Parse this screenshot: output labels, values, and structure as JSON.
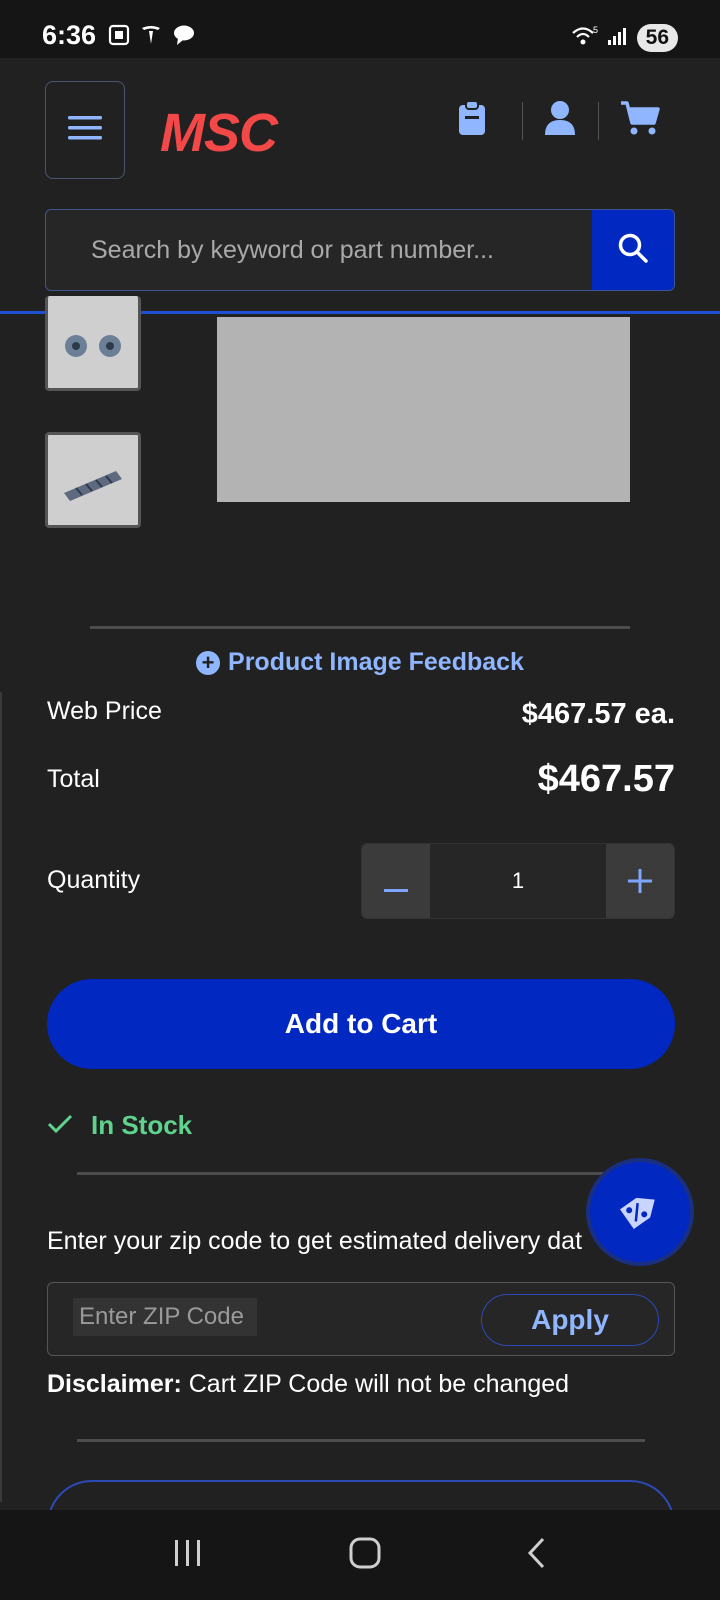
{
  "status_bar": {
    "time": "6:36",
    "battery": "56",
    "left_icons": [
      "screenshot-icon",
      "tesla-icon",
      "chat-bubble-icon"
    ],
    "right_icons": [
      "wifi-icon",
      "signal-icon",
      "battery-icon"
    ]
  },
  "header": {
    "logo": "MSC",
    "logo_color": "#f24848",
    "icons": [
      "menu-icon",
      "clipboard-icon",
      "user-icon",
      "cart-icon"
    ],
    "search_placeholder": "Search by keyword or part number...",
    "accent": "#0228c2"
  },
  "product": {
    "feedback_link": "Product Image Feedback",
    "web_price_label": "Web Price",
    "web_price_value": "$467.57 ea.",
    "total_label": "Total",
    "total_value": "$467.57",
    "quantity_label": "Quantity",
    "quantity_value": "1",
    "add_to_cart": "Add to Cart",
    "stock_status": "In Stock",
    "stock_color": "#5fd38e"
  },
  "delivery": {
    "prompt": "Enter your zip code to get estimated delivery dat",
    "zip_placeholder": "Enter ZIP Code",
    "apply_label": "Apply",
    "disclaimer_bold": "Disclaimer:",
    "disclaimer_text": " Cart ZIP Code will not be changed"
  },
  "nav_bar": {
    "icons": [
      "recents-icon",
      "home-icon",
      "back-icon"
    ]
  }
}
